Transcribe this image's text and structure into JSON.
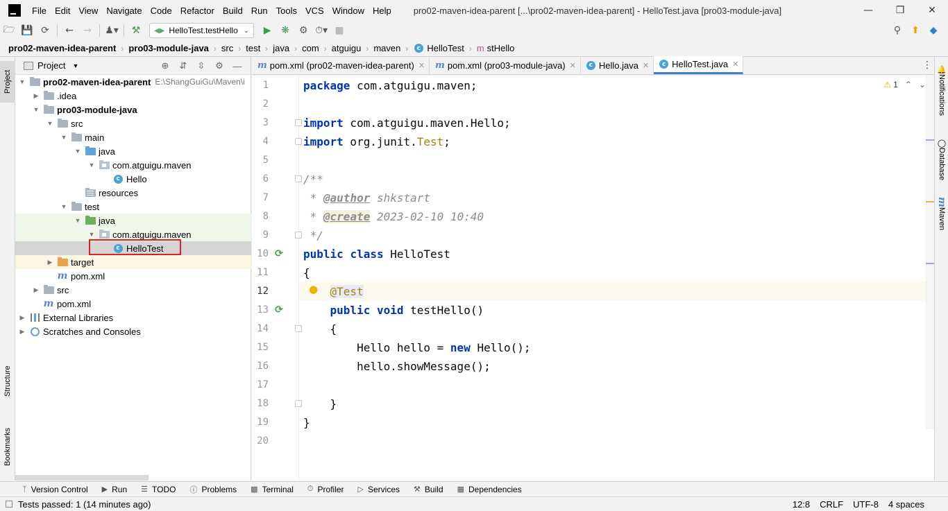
{
  "window": {
    "title": "pro02-maven-idea-parent [...\\pro02-maven-idea-parent] - HelloTest.java [pro03-module-java]"
  },
  "menu": [
    {
      "label": "File"
    },
    {
      "label": "Edit"
    },
    {
      "label": "View"
    },
    {
      "label": "Navigate"
    },
    {
      "label": "Code"
    },
    {
      "label": "Refactor"
    },
    {
      "label": "Build"
    },
    {
      "label": "Run"
    },
    {
      "label": "Tools"
    },
    {
      "label": "VCS"
    },
    {
      "label": "Window"
    },
    {
      "label": "Help"
    }
  ],
  "toolbar": {
    "run_config": "HelloTest.testHello"
  },
  "breadcrumb": [
    "pro02-maven-idea-parent",
    "pro03-module-java",
    "src",
    "test",
    "java",
    "com",
    "atguigu",
    "maven",
    "HelloTest",
    "stHello"
  ],
  "left_strip": {
    "project": "Project",
    "structure": "Structure",
    "bookmarks": "Bookmarks"
  },
  "right_strip": {
    "notifications": "Notifications",
    "database": "Database",
    "maven": "Maven"
  },
  "project_panel": {
    "title": "Project",
    "tree": [
      {
        "label": "pro02-maven-idea-parent",
        "hint": "E:\\ShangGuiGu\\Maven\\i"
      },
      {
        "label": ".idea"
      },
      {
        "label": "pro03-module-java"
      },
      {
        "label": "src"
      },
      {
        "label": "main"
      },
      {
        "label": "java"
      },
      {
        "label": "com.atguigu.maven"
      },
      {
        "label": "Hello"
      },
      {
        "label": "resources"
      },
      {
        "label": "test"
      },
      {
        "label": "java"
      },
      {
        "label": "com.atguigu.maven"
      },
      {
        "label": "HelloTest"
      },
      {
        "label": "target"
      },
      {
        "label": "pom.xml"
      },
      {
        "label": "src"
      },
      {
        "label": "pom.xml"
      },
      {
        "label": "External Libraries"
      },
      {
        "label": "Scratches and Consoles"
      }
    ]
  },
  "editor": {
    "tabs": [
      {
        "label": "pom.xml (pro02-maven-idea-parent)"
      },
      {
        "label": "pom.xml (pro03-module-java)"
      },
      {
        "label": "Hello.java"
      },
      {
        "label": "HelloTest.java"
      }
    ],
    "warnings_count": "1",
    "line_numbers": [
      "1",
      "2",
      "3",
      "4",
      "5",
      "6",
      "7",
      "8",
      "9",
      "10",
      "11",
      "12",
      "13",
      "14",
      "15",
      "16",
      "17",
      "18",
      "19",
      "20"
    ],
    "code": {
      "l1_kw": "package",
      "l1_rest": " com.atguigu.maven;",
      "l3_kw": "import",
      "l3_rest": " com.atguigu.maven.Hello;",
      "l4_kw": "import",
      "l4_a": " org.junit.",
      "l4_b": "Test",
      "l4_c": ";",
      "l6": "/**",
      "l7_a": " * ",
      "l7_tag": "@author",
      "l7_b": " shkstart",
      "l8_a": " * ",
      "l8_tag": "@create",
      "l8_b": " 2023-02-10 10:40",
      "l9": " */",
      "l10_kw1": "public",
      "l10_kw2": "class",
      "l10_rest": " HelloTest",
      "l11": "{",
      "l12_ann": "@Test",
      "l13_kw1": "public",
      "l13_kw2": "void",
      "l13_rest": " testHello()",
      "l14": "    {",
      "l15_a": "        Hello hello = ",
      "l15_kw": "new",
      "l15_b": " Hello();",
      "l16": "        hello.showMessage();",
      "l18": "    }",
      "l19": "}"
    }
  },
  "bottom_tools": [
    {
      "label": "Version Control"
    },
    {
      "label": "Run"
    },
    {
      "label": "TODO"
    },
    {
      "label": "Problems"
    },
    {
      "label": "Terminal"
    },
    {
      "label": "Profiler"
    },
    {
      "label": "Services"
    },
    {
      "label": "Build"
    },
    {
      "label": "Dependencies"
    }
  ],
  "status": {
    "message": "Tests passed: 1 (14 minutes ago)",
    "position": "12:8",
    "line_sep": "CRLF",
    "encoding": "UTF-8",
    "indent": "4 spaces"
  }
}
